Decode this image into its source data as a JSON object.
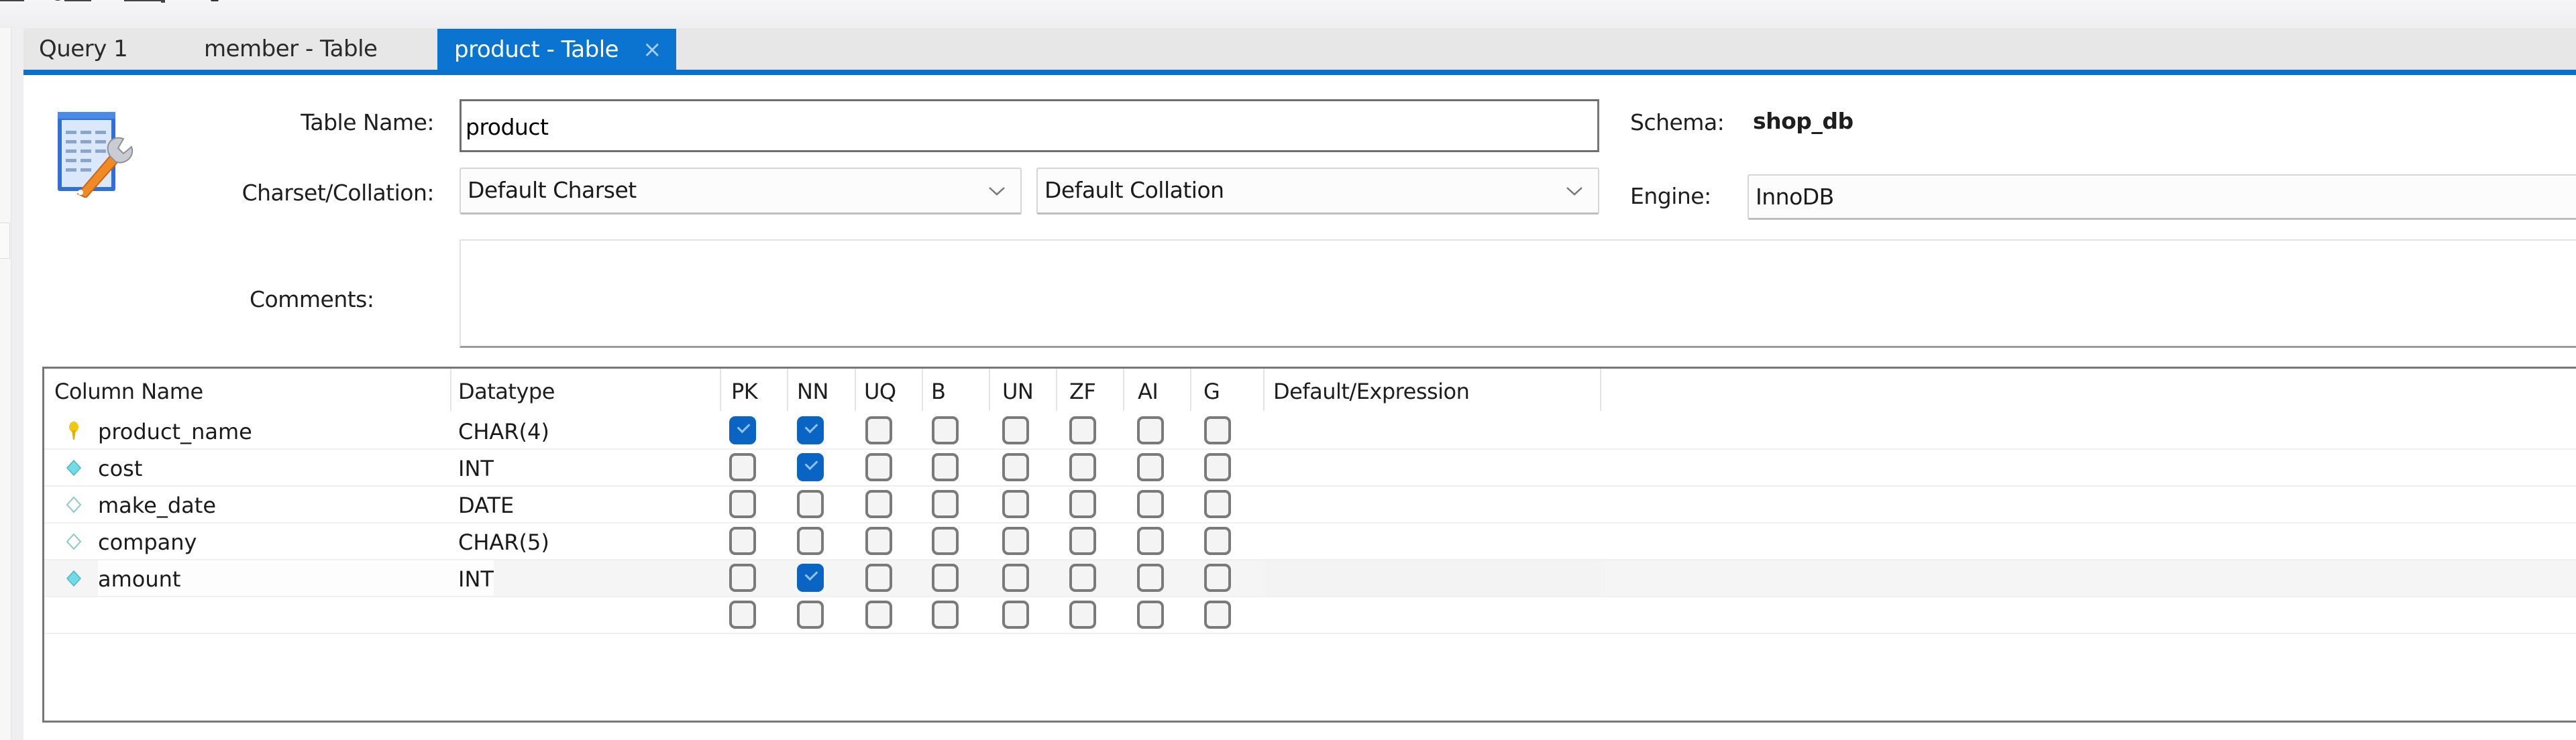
{
  "toolbar": {
    "icons": [
      "toolbar-icon-1",
      "toolbar-icon-2",
      "toolbar-icon-3",
      "toolbar-icon-4"
    ]
  },
  "tabs": [
    {
      "label": "Query 1",
      "active": false
    },
    {
      "label": "member - Table",
      "active": false
    },
    {
      "label": "product - Table",
      "active": true,
      "close": "×"
    }
  ],
  "form": {
    "icon": "table-edit-icon",
    "table_name_label": "Table Name:",
    "table_name_value": "product",
    "charset_label": "Charset/Collation:",
    "charset_value": "Default Charset",
    "collation_value": "Default Collation",
    "comments_label": "Comments:",
    "comments_value": "",
    "schema_label": "Schema:",
    "schema_value": "shop_db",
    "engine_label": "Engine:",
    "engine_value": "InnoDB"
  },
  "grid": {
    "headers": {
      "column_name": "Column Name",
      "datatype": "Datatype",
      "flags": [
        "PK",
        "NN",
        "UQ",
        "B",
        "UN",
        "ZF",
        "AI",
        "G"
      ],
      "default": "Default/Expression"
    },
    "rows": [
      {
        "name": "product_name",
        "icon": "primary-key-icon",
        "datatype": "CHAR(4)",
        "flags": [
          true,
          true,
          false,
          false,
          false,
          false,
          false,
          false
        ],
        "default": "",
        "selected": false
      },
      {
        "name": "cost",
        "icon": "not-null-column-icon",
        "datatype": "INT",
        "flags": [
          false,
          true,
          false,
          false,
          false,
          false,
          false,
          false
        ],
        "default": "",
        "selected": false
      },
      {
        "name": "make_date",
        "icon": "nullable-column-icon",
        "datatype": "DATE",
        "flags": [
          false,
          false,
          false,
          false,
          false,
          false,
          false,
          false
        ],
        "default": "",
        "selected": false
      },
      {
        "name": "company",
        "icon": "nullable-column-icon",
        "datatype": "CHAR(5)",
        "flags": [
          false,
          false,
          false,
          false,
          false,
          false,
          false,
          false
        ],
        "default": "",
        "selected": false
      },
      {
        "name": "amount",
        "icon": "not-null-column-icon",
        "datatype": "INT",
        "flags": [
          false,
          true,
          false,
          false,
          false,
          false,
          false,
          false
        ],
        "default": "",
        "selected": true
      },
      {
        "name": "",
        "icon": "",
        "datatype": "",
        "flags": [
          false,
          false,
          false,
          false,
          false,
          false,
          false,
          false
        ],
        "default": "",
        "selected": false
      }
    ]
  },
  "colors": {
    "accent": "#0a74d0",
    "checkbox_checked": "#0a64c4",
    "primary_key": "#f2c611",
    "column_diamond": "#5fd3e0"
  }
}
